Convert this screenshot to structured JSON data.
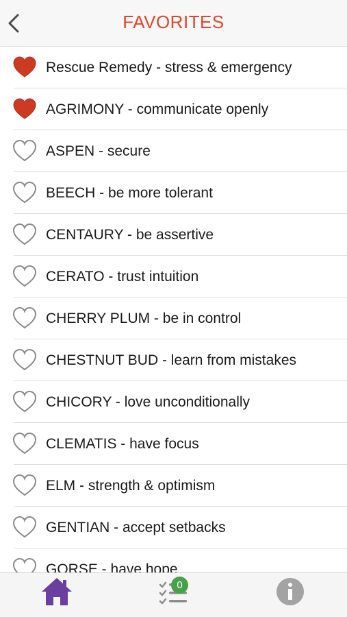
{
  "header": {
    "title": "FAVORITES",
    "back_icon": "chevron-left-icon"
  },
  "colors": {
    "accent": "#e2452a",
    "heart_filled": "#cc3a22",
    "heart_outline": "#8a8a8a",
    "home_active": "#6b3fa0",
    "badge": "#47a04a"
  },
  "items": [
    {
      "label": "Rescue Remedy - stress & emergency",
      "favorite": true
    },
    {
      "label": "AGRIMONY - communicate openly",
      "favorite": true
    },
    {
      "label": "ASPEN - secure",
      "favorite": false
    },
    {
      "label": "BEECH - be more tolerant",
      "favorite": false
    },
    {
      "label": "CENTAURY - be assertive",
      "favorite": false
    },
    {
      "label": "CERATO - trust intuition",
      "favorite": false
    },
    {
      "label": "CHERRY PLUM - be in control",
      "favorite": false
    },
    {
      "label": "CHESTNUT BUD - learn from mistakes",
      "favorite": false
    },
    {
      "label": "CHICORY - love unconditionally",
      "favorite": false
    },
    {
      "label": "CLEMATIS - have focus",
      "favorite": false
    },
    {
      "label": "ELM - strength & optimism",
      "favorite": false
    },
    {
      "label": "GENTIAN - accept setbacks",
      "favorite": false
    },
    {
      "label": "GORSE - have hope",
      "favorite": false
    }
  ],
  "tabbar": {
    "home_icon": "home-icon",
    "list_icon": "checklist-icon",
    "list_badge": "0",
    "info_icon": "info-icon"
  }
}
